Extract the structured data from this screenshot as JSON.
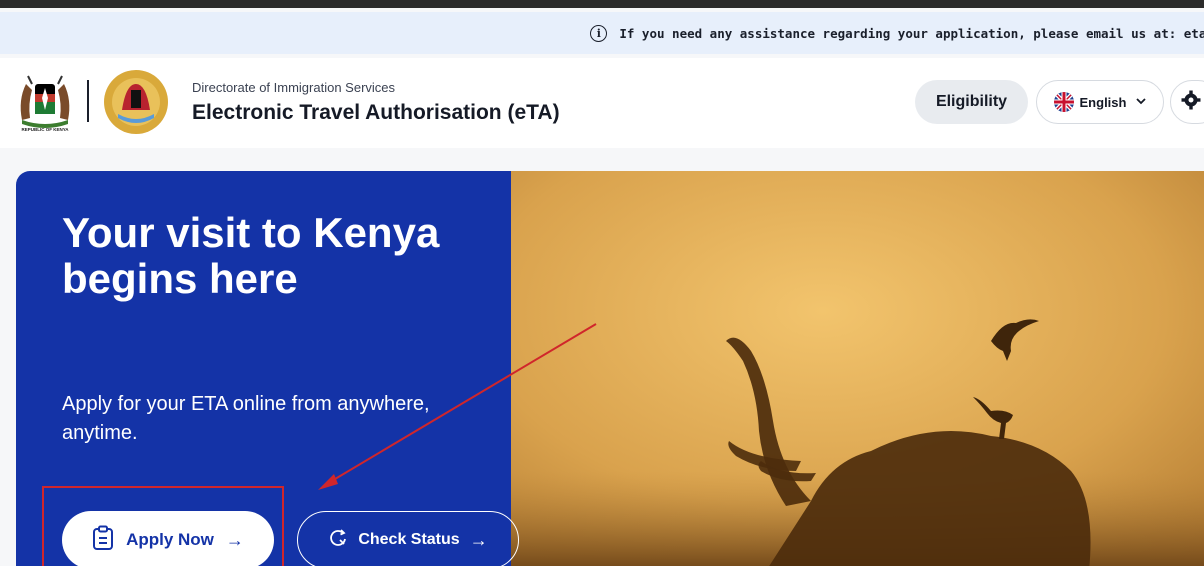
{
  "info_bar": {
    "text": "If you need any assistance regarding your application, please email us at: etakenya"
  },
  "header": {
    "subtitle": "Directorate of Immigration Services",
    "title": "Electronic Travel Authorisation (eTA)",
    "eligibility_label": "Eligibility",
    "language_label": "English",
    "coat_of_arms_text": "REPUBLIC OF KENYA"
  },
  "hero": {
    "title": "Your visit to Kenya begins here",
    "subtitle": "Apply for your ETA online from anywhere, anytime.",
    "apply_label": "Apply Now",
    "check_label": "Check Status",
    "background_color": "#1433a7"
  },
  "icons": {
    "info": "info-icon",
    "flag": "uk-flag-icon",
    "chevron": "chevron-down-icon",
    "settings": "gear-icon",
    "apply": "clipboard-icon",
    "check": "refresh-search-icon",
    "arrow": "arrow-right-icon"
  },
  "annotation": {
    "color": "#d0262b"
  }
}
